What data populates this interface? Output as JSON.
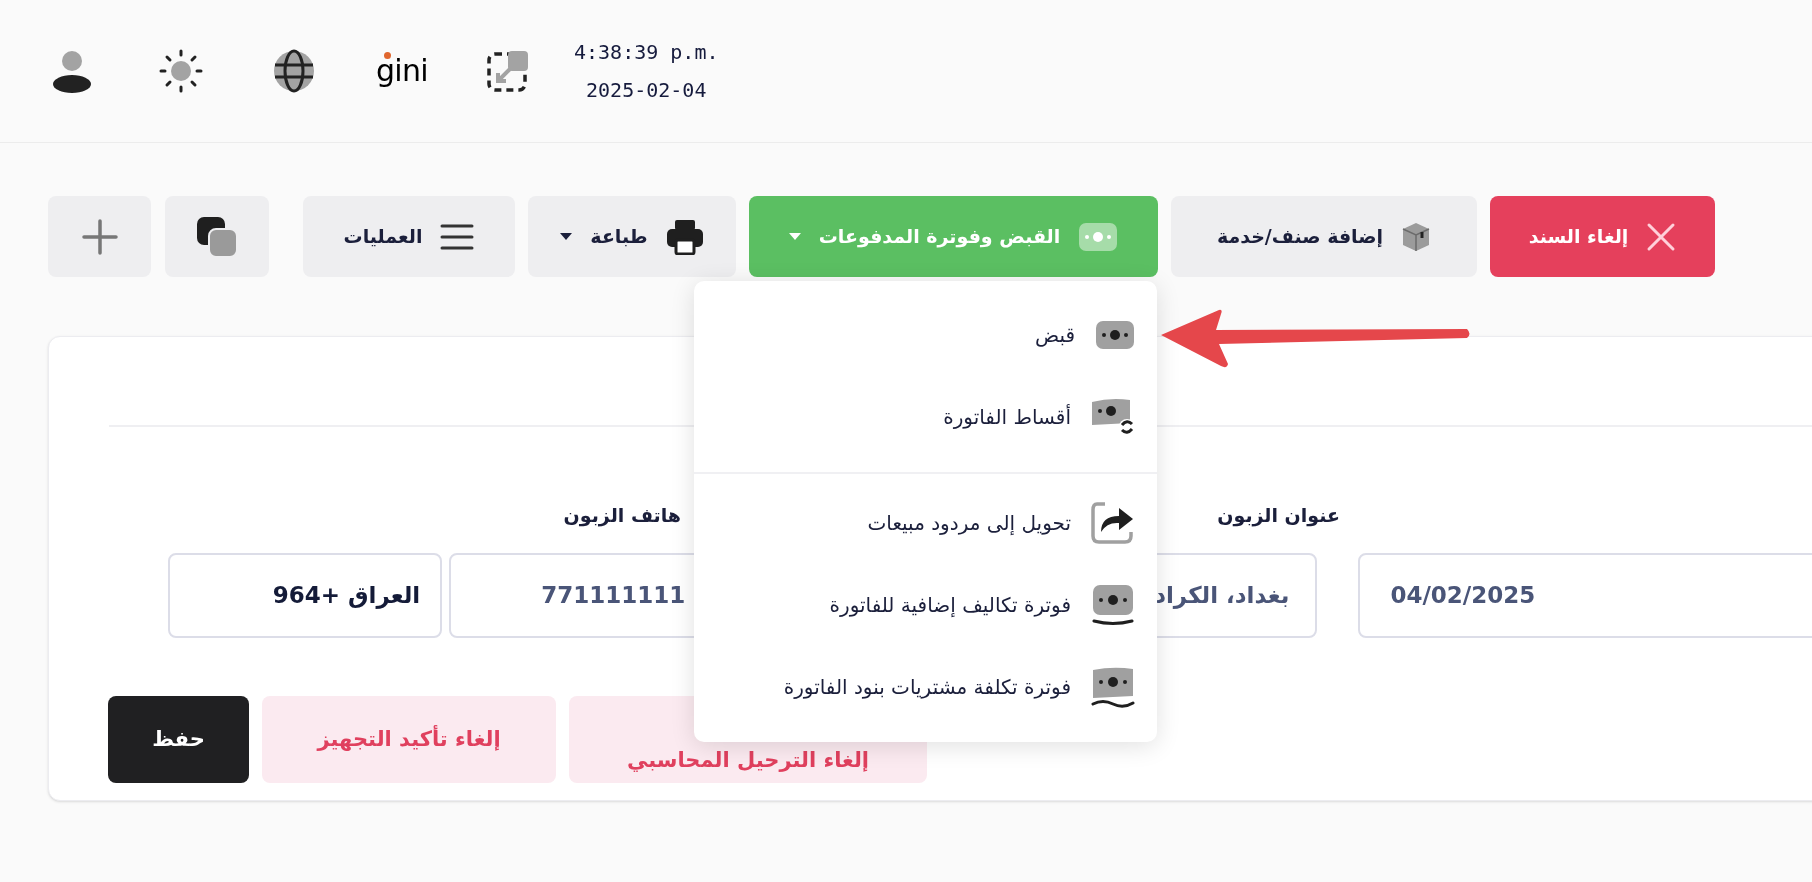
{
  "header": {
    "logo": "gini",
    "time": "4:38:39 p.m.",
    "date": "2025-02-04"
  },
  "toolbar": [
    {
      "label": "إلغاء السند",
      "kind": "danger",
      "dropdown": false
    },
    {
      "label": "إضافة صنف/خدمة",
      "kind": "neutral",
      "dropdown": false
    },
    {
      "label": "القبض وفوترة المدفوعات",
      "kind": "success",
      "dropdown": true
    },
    {
      "label": "طباعة",
      "kind": "neutral",
      "dropdown": true
    },
    {
      "label": "العمليات",
      "kind": "neutral",
      "dropdown": false
    }
  ],
  "menu": {
    "groups": [
      [
        {
          "label": "قبض"
        },
        {
          "label": "أقساط الفاتورة"
        }
      ],
      [
        {
          "label": "تحويل إلى مردود مبيعات"
        },
        {
          "label": "فوترة تكاليف إضافية للفاتورة"
        },
        {
          "label": "فوترة تكلفة مشتريات بنود الفاتورة"
        }
      ]
    ]
  },
  "form": {
    "fields": [
      {
        "label": "عنوان الزبون"
      },
      {
        "label": "هاتف الزبون"
      }
    ],
    "date_value": "04/02/2025",
    "address_value": "بغداد، الكراد",
    "phone_value": "771111111",
    "country_value": "العراق +964"
  },
  "actions": [
    {
      "label": "إلغاء الترحيل المحاسبي",
      "kind": "soft"
    },
    {
      "label": "إلغاء تأكيد التجهيز",
      "kind": "soft"
    },
    {
      "label": "حفظ",
      "kind": "dark"
    }
  ]
}
